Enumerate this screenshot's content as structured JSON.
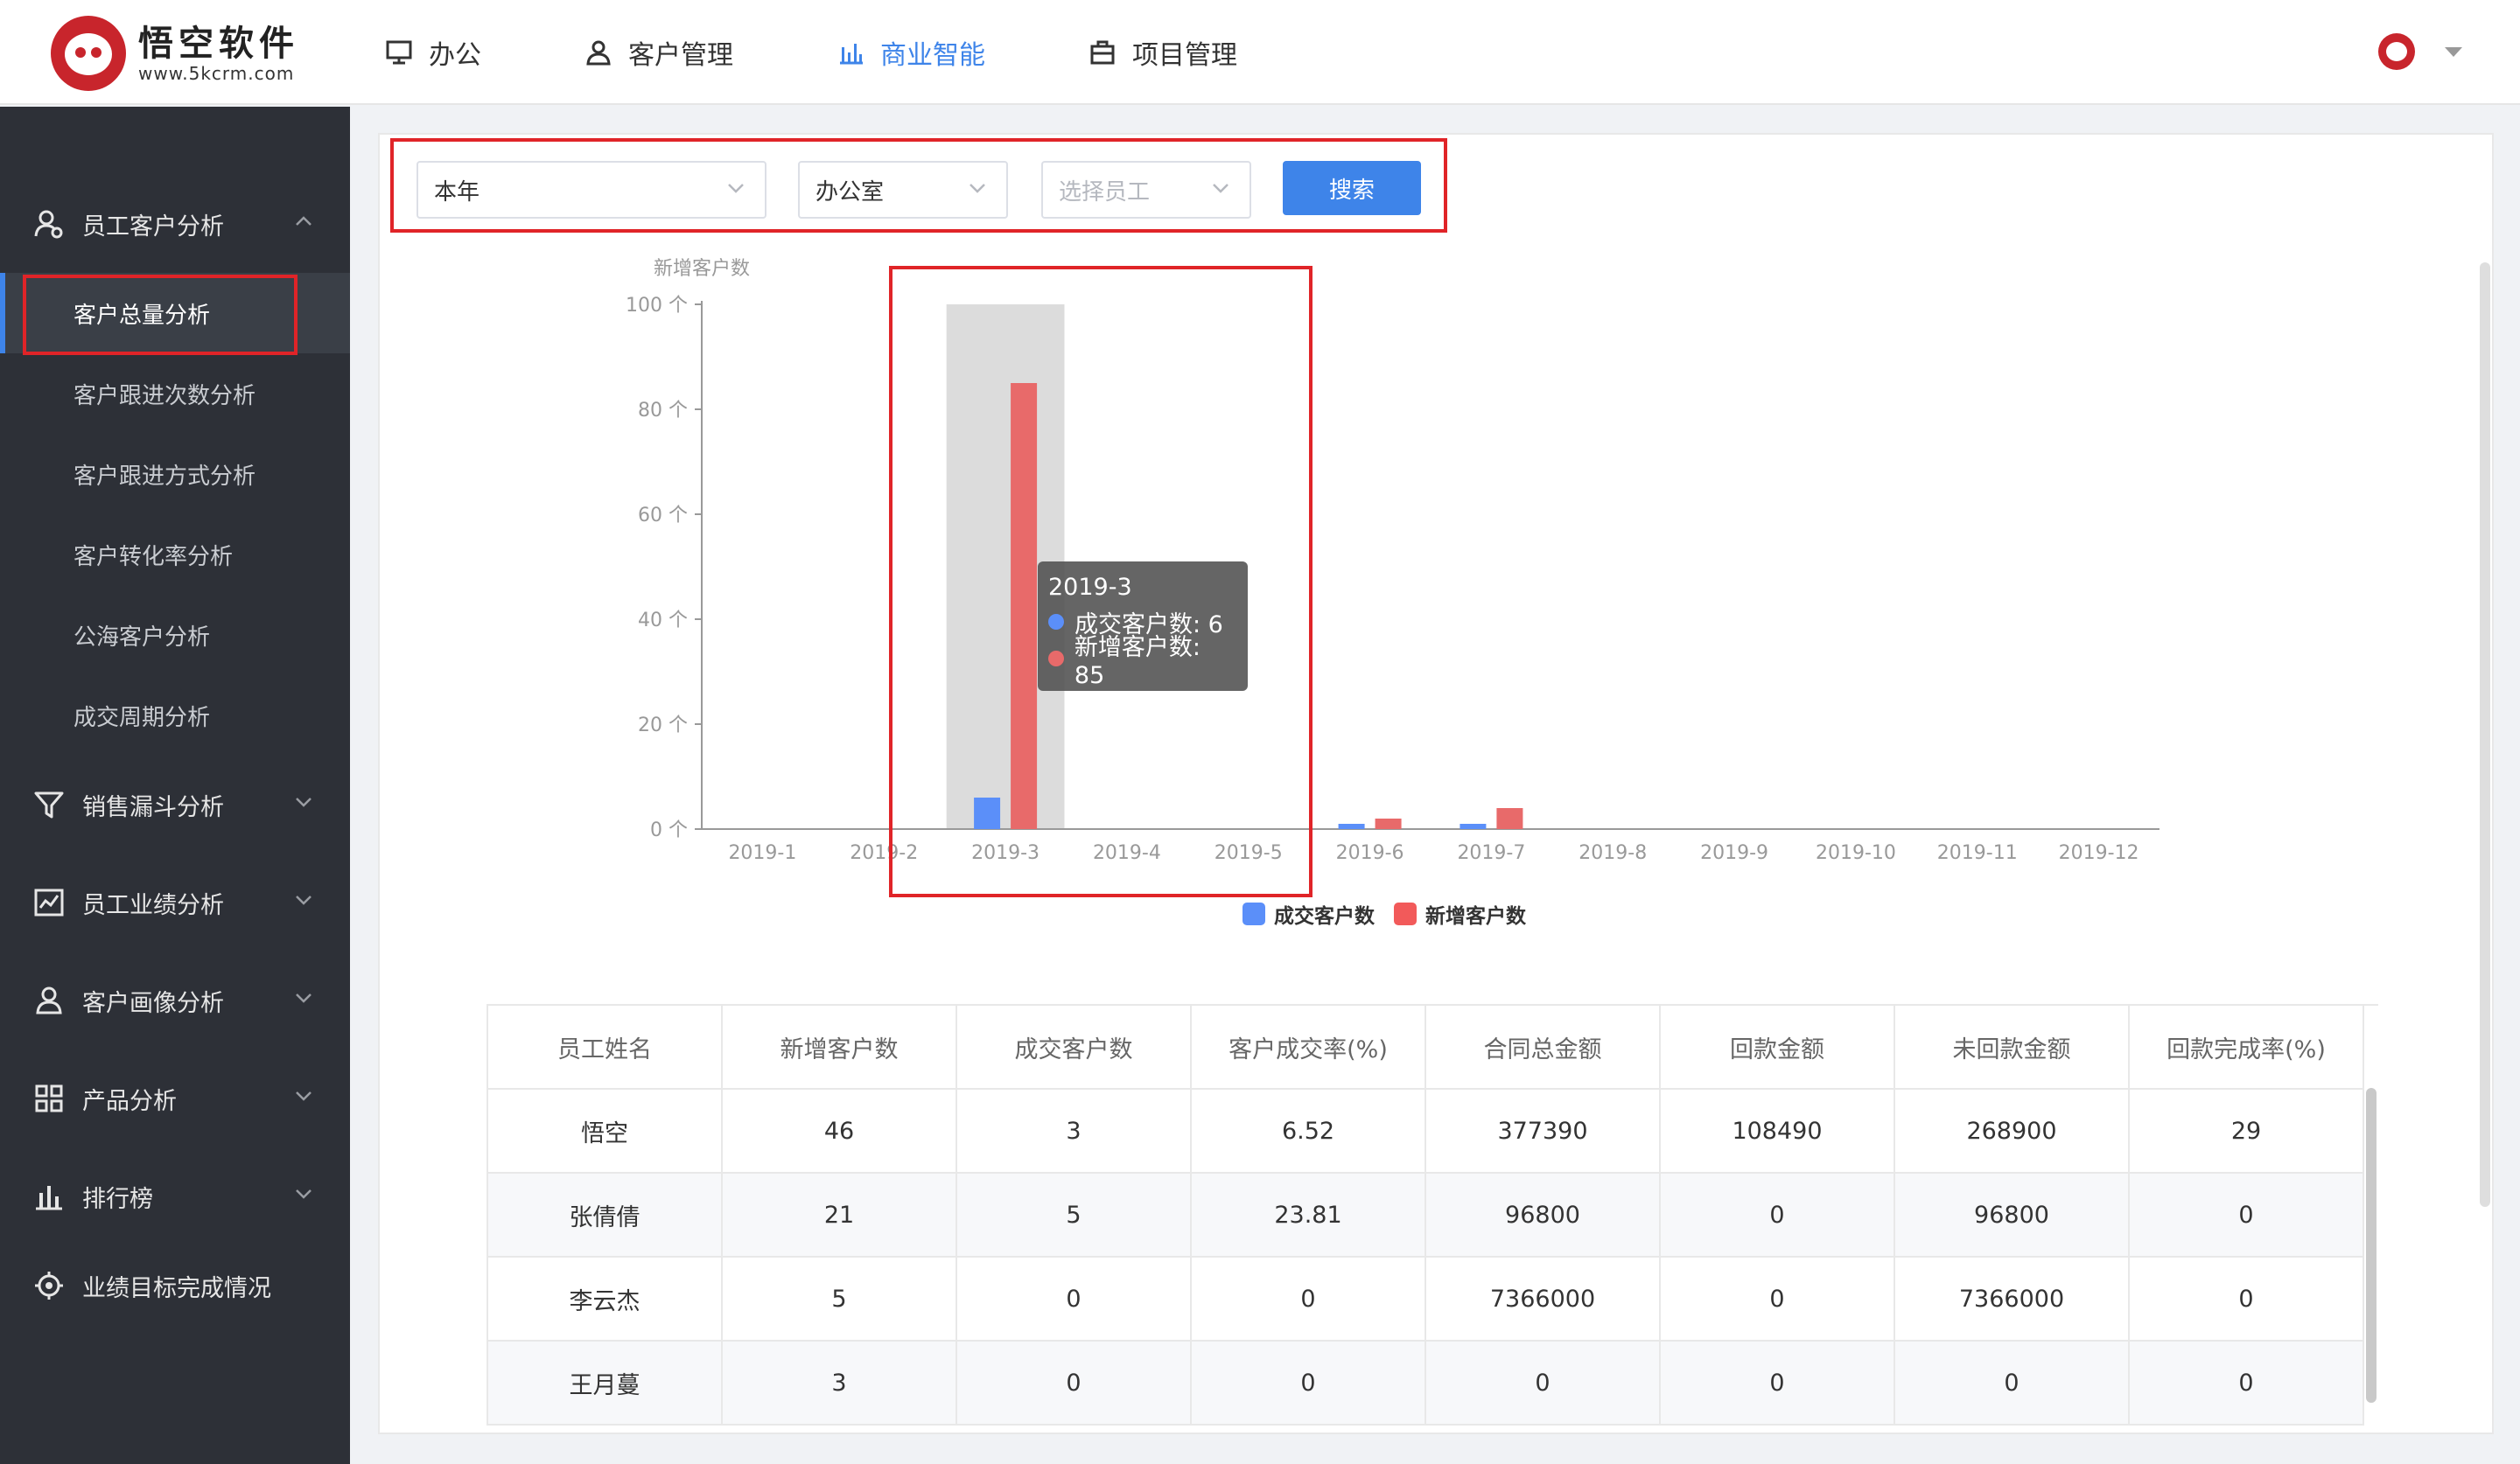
{
  "header": {
    "logo_name": "悟空软件",
    "logo_url": "www.5kcrm.com",
    "nav": [
      {
        "label": "办公",
        "icon": "monitor-icon"
      },
      {
        "label": "客户管理",
        "icon": "user-icon"
      },
      {
        "label": "商业智能",
        "icon": "bar-chart-icon",
        "active": true
      },
      {
        "label": "项目管理",
        "icon": "briefcase-icon"
      }
    ]
  },
  "sidebar": {
    "groups": [
      {
        "label": "员工客户分析",
        "icon": "employee-user-icon",
        "expanded": true
      },
      {
        "label": "销售漏斗分析",
        "icon": "funnel-icon"
      },
      {
        "label": "员工业绩分析",
        "icon": "line-chart-icon"
      },
      {
        "label": "客户画像分析",
        "icon": "user-portrait-icon"
      },
      {
        "label": "产品分析",
        "icon": "grid-icon"
      },
      {
        "label": "排行榜",
        "icon": "ranking-icon"
      },
      {
        "label": "业绩目标完成情况",
        "icon": "target-icon"
      }
    ],
    "sub_items": [
      {
        "label": "客户总量分析",
        "active": true
      },
      {
        "label": "客户跟进次数分析"
      },
      {
        "label": "客户跟进方式分析"
      },
      {
        "label": "客户转化率分析"
      },
      {
        "label": "公海客户分析"
      },
      {
        "label": "成交周期分析"
      }
    ]
  },
  "filters": {
    "period": "本年",
    "department": "办公室",
    "employee_placeholder": "选择员工",
    "search_label": "搜索"
  },
  "colors": {
    "accent": "#3e84e9",
    "series_deal": "#5b8ff9",
    "series_new": "#e86a6a",
    "highlight": "#e02428"
  },
  "chart_data": {
    "type": "bar",
    "ylabel": "新增客户数",
    "ylim": [
      0,
      100
    ],
    "y_ticks": [
      "0 个",
      "20 个",
      "40 个",
      "60 个",
      "80 个",
      "100 个"
    ],
    "categories": [
      "2019-1",
      "2019-2",
      "2019-3",
      "2019-4",
      "2019-5",
      "2019-6",
      "2019-7",
      "2019-8",
      "2019-9",
      "2019-10",
      "2019-11",
      "2019-12"
    ],
    "series": [
      {
        "name": "成交客户数",
        "values": [
          0,
          0,
          6,
          0,
          0,
          1,
          1,
          0,
          0,
          0,
          0,
          0
        ]
      },
      {
        "name": "新增客户数",
        "values": [
          0,
          0,
          85,
          0,
          0,
          2,
          4,
          0,
          0,
          0,
          0,
          0
        ]
      }
    ],
    "highlighted_category": "2019-3",
    "tooltip": {
      "title": "2019-3",
      "lines": [
        "成交客户数: 6",
        "新增客户数: 85"
      ]
    },
    "legend_position": "bottom"
  },
  "table": {
    "columns": [
      "员工姓名",
      "新增客户数",
      "成交客户数",
      "客户成交率(%)",
      "合同总金额",
      "回款金额",
      "未回款金额",
      "回款完成率(%)"
    ],
    "rows": [
      [
        "悟空",
        "46",
        "3",
        "6.52",
        "377390",
        "108490",
        "268900",
        "29"
      ],
      [
        "张倩倩",
        "21",
        "5",
        "23.81",
        "96800",
        "0",
        "96800",
        "0"
      ],
      [
        "李云杰",
        "5",
        "0",
        "0",
        "7366000",
        "0",
        "7366000",
        "0"
      ],
      [
        "王月蔓",
        "3",
        "0",
        "0",
        "0",
        "0",
        "0",
        "0"
      ]
    ]
  }
}
